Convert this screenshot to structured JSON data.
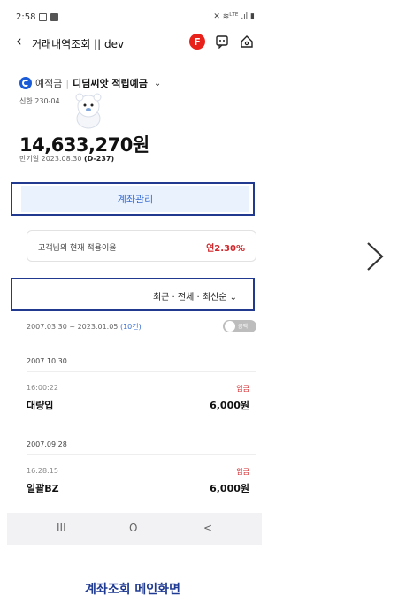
{
  "status": {
    "time": "2:58",
    "right": "✕ ≋ᴸᵀᴱ .ıl ▮"
  },
  "nav": {
    "back": "‹",
    "title": "거래내역조회 || dev",
    "f_badge": "F"
  },
  "account": {
    "type": "예적금",
    "sep": "|",
    "name": "디딤씨앗 적립예금",
    "number": "신한 230-04",
    "balance": "14,633,270원",
    "maturity_label": "만기일 2023.08.30",
    "maturity_dday": "(D-237)"
  },
  "manage_button": "계좌관리",
  "rate": {
    "label": "고객님의 현재 적용이율",
    "value": "연2.30%"
  },
  "filter": {
    "label": "최근 · 전체 · 최신순 ⌄"
  },
  "range": {
    "text": "2007.03.30 ~ 2023.01.05",
    "count": "(10건)"
  },
  "toggle_label": "금액",
  "transactions": [
    {
      "date": "2007.10.30",
      "time": "16:00:22",
      "type": "입금",
      "name": "대량입",
      "amount": "6,000원"
    },
    {
      "date": "2007.09.28",
      "time": "16:28:15",
      "type": "입금",
      "name": "일괄BZ",
      "amount": "6,000원"
    }
  ],
  "sysnav": {
    "recent": "III",
    "home": "O",
    "back": "<"
  },
  "caption": "계좌조회 메인화면",
  "colors": {
    "accent_red": "#d0282c",
    "accent_blue": "#3b6ed3",
    "highlight_border": "#213a8f",
    "brand_blue": "#1a5bd8"
  }
}
